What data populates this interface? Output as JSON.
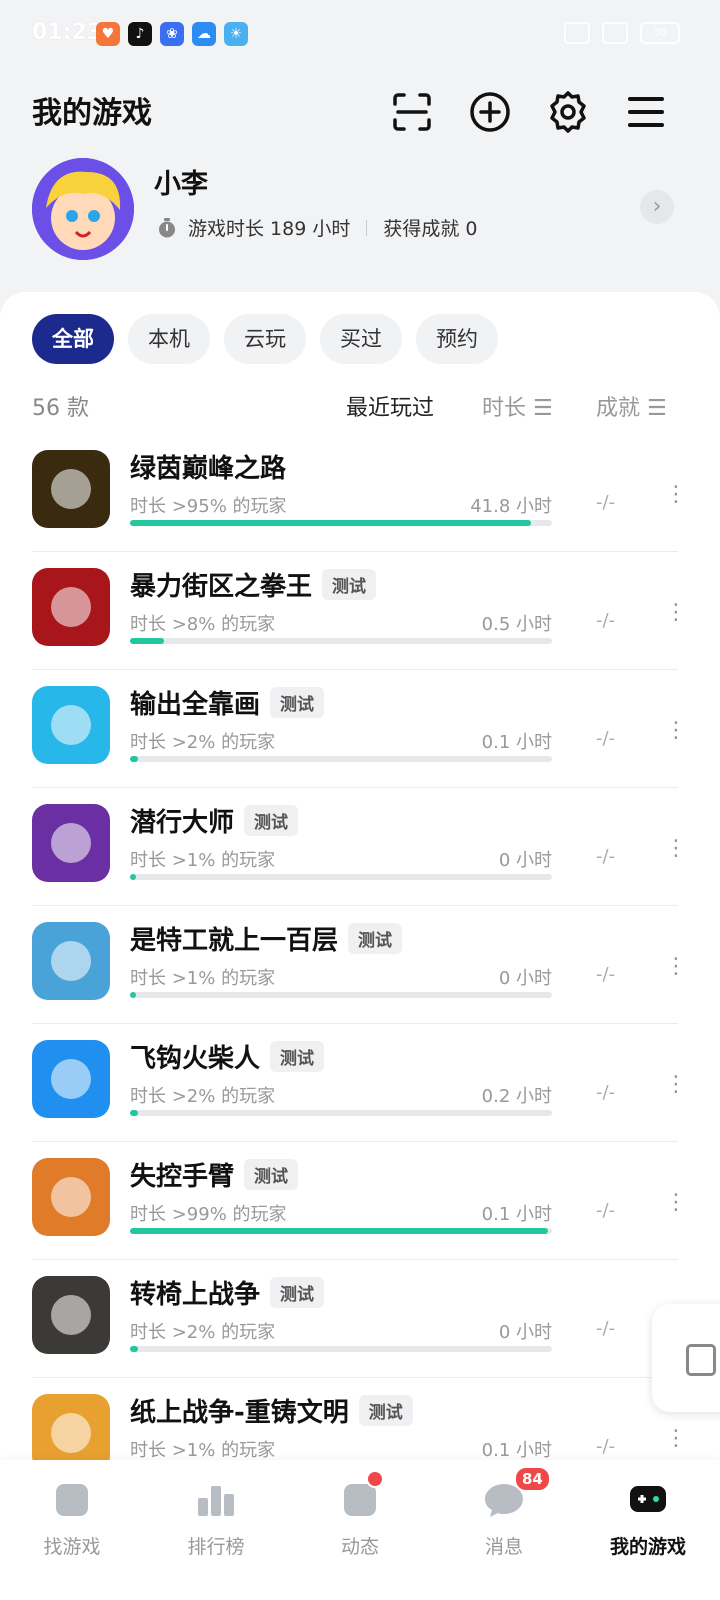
{
  "status": {
    "time": "01:23",
    "battery": "30"
  },
  "header": {
    "title": "我的游戏"
  },
  "profile": {
    "name": "小李",
    "playtime": "游戏时长 189 小时",
    "achievements": "获得成就 0"
  },
  "filters": [
    "全部",
    "本机",
    "云玩",
    "买过",
    "预约"
  ],
  "list": {
    "count": "56 款",
    "sort": [
      "最近玩过",
      "时长",
      "成就"
    ]
  },
  "games": [
    {
      "name": "绿茵巅峰之路",
      "badge": "",
      "pct": "时长 >95% 的玩家",
      "hours": "41.8 小时",
      "fill": 0.95,
      "ach": "-/-",
      "color": "#3a2a10",
      "icon": "soccer-ball-icon"
    },
    {
      "name": "暴力街区之拳王",
      "badge": "测试",
      "pct": "时长 >8% 的玩家",
      "hours": "0.5 小时",
      "fill": 0.08,
      "ach": "-/-",
      "color": "#a8161c",
      "icon": "fist-icon"
    },
    {
      "name": "输出全靠画",
      "badge": "测试",
      "pct": "时长 >2% 的玩家",
      "hours": "0.1 小时",
      "fill": 0.02,
      "ach": "-/-",
      "color": "#27b7e8",
      "icon": "stickman-icon"
    },
    {
      "name": "潜行大师",
      "badge": "测试",
      "pct": "时长 >1% 的玩家",
      "hours": "0 小时",
      "fill": 0.01,
      "ach": "-/-",
      "color": "#6a2fa3",
      "icon": "ninja-icon"
    },
    {
      "name": "是特工就上一百层",
      "badge": "测试",
      "pct": "时长 >1% 的玩家",
      "hours": "0 小时",
      "fill": 0.01,
      "ach": "-/-",
      "color": "#4aa3d8",
      "icon": "agent-icon"
    },
    {
      "name": "飞钩火柴人",
      "badge": "测试",
      "pct": "时长 >2% 的玩家",
      "hours": "0.2 小时",
      "fill": 0.02,
      "ach": "-/-",
      "color": "#1f8ff0",
      "icon": "hook-stickman-icon"
    },
    {
      "name": "失控手臂",
      "badge": "测试",
      "pct": "时长 >99% 的玩家",
      "hours": "0.1 小时",
      "fill": 0.99,
      "ach": "-/-",
      "color": "#e07b2a",
      "icon": "arm-icon"
    },
    {
      "name": "转椅上战争",
      "badge": "测试",
      "pct": "时长 >2% 的玩家",
      "hours": "0 小时",
      "fill": 0.02,
      "ach": "-/-",
      "color": "#3c3a36",
      "icon": "office-chair-icon"
    },
    {
      "name": "纸上战争-重铸文明",
      "badge": "测试",
      "pct": "时长 >1% 的玩家",
      "hours": "0.1 小时",
      "fill": 0.01,
      "ach": "-/-",
      "color": "#e8a030",
      "icon": "cowboy-icon"
    }
  ],
  "nav": [
    {
      "label": "找游戏",
      "icon": "find-game-icon"
    },
    {
      "label": "排行榜",
      "icon": "ranking-icon"
    },
    {
      "label": "动态",
      "icon": "feed-icon"
    },
    {
      "label": "消息",
      "icon": "message-icon",
      "badge": "84"
    },
    {
      "label": "我的游戏",
      "icon": "gamepad-icon"
    }
  ]
}
